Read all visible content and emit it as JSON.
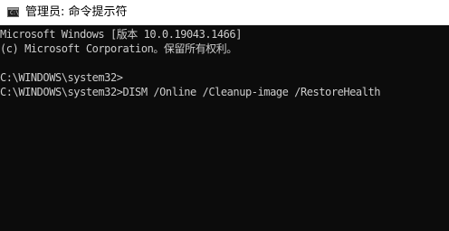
{
  "window": {
    "title": "管理员: 命令提示符",
    "icon": "cmd-icon"
  },
  "console": {
    "lines": [
      "Microsoft Windows [版本 10.0.19043.1466]",
      "(c) Microsoft Corporation。保留所有权利。",
      "C:\\WINDOWS\\system32>",
      "C:\\WINDOWS\\system32>DISM /Online /Cleanup-image /RestoreHealth"
    ]
  },
  "colors": {
    "background": "#0c0c0c",
    "text": "#cccccc",
    "titlebar": "#ffffff"
  }
}
